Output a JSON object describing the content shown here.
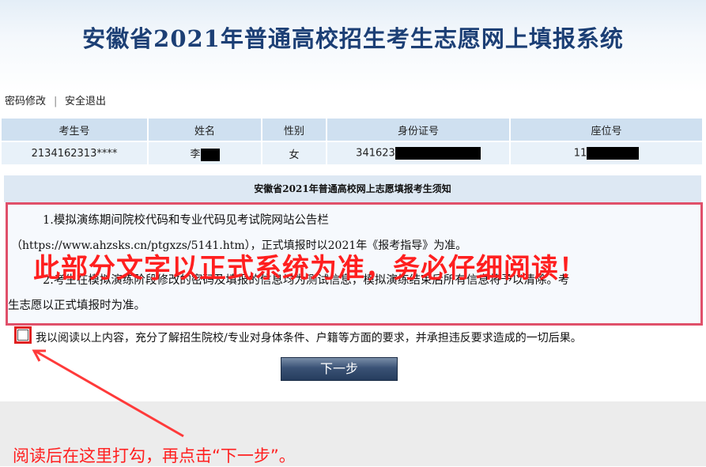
{
  "header": {
    "title": "安徽省2021年普通高校招生考生志愿网上填报系统"
  },
  "nav": {
    "change_password": "密码修改",
    "separator": "|",
    "logout": "安全退出"
  },
  "info_table": {
    "headers": [
      "考生号",
      "姓名",
      "性别",
      "身份证号",
      "座位号"
    ],
    "row": {
      "exam_no": "2134162313****",
      "name": "李",
      "gender": "女",
      "id_no": "341623",
      "seat_no": "11"
    }
  },
  "notice": {
    "title": "安徽省2021年普通高校网上志愿填报考生须知",
    "line1": "1.模拟演练期间院校代码和专业代码见考试院网站公告栏",
    "line2": "（https://www.ahzsks.cn/ptgxzs/5141.htm），正式填报时以2021年《报考指导》为准。",
    "line3": "2.考生在模拟演练阶段修改的密码及填报的信息均为测试信息，模拟演练结束后所有信息将予以清除。考",
    "line4": "生志愿以正式填报时为准。",
    "overlay": "此部分文字以正式系统为准，务必仔细阅读！"
  },
  "agreement": {
    "text": "我以阅读以上内容，充分了解招生院校/专业对身体条件、户籍等方面的要求，并承担违反要求造成的一切后果。"
  },
  "buttons": {
    "next": "下一步"
  },
  "annotation": {
    "note": "阅读后在这里打勾，再点击“下一步”。"
  },
  "colors": {
    "banner_title": "#1c3f75",
    "highlight_red": "#e02020",
    "notice_border": "#e0506a",
    "button": "#2e4669"
  }
}
